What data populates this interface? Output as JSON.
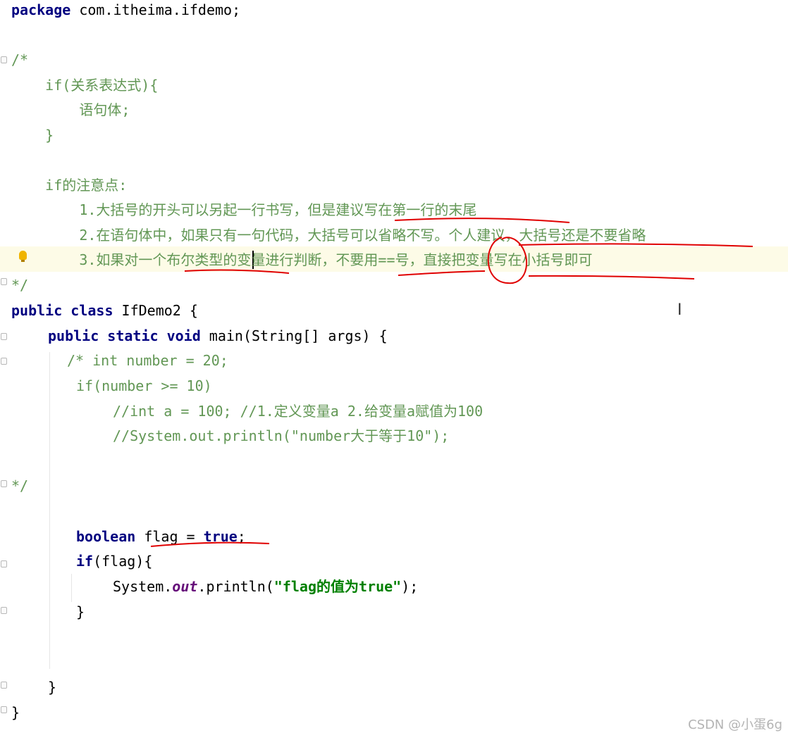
{
  "code": {
    "l1_kw": "package",
    "l1_rest": " com.itheima.ifdemo;",
    "c_open": "/*",
    "c_if": "    if(关系表达式){",
    "c_body": "        语句体;",
    "c_close_brace": "    }",
    "c_notes_title": "    if的注意点:",
    "c_note1": "        1.大括号的开头可以另起一行书写，但是建议写在第一行的末尾",
    "c_note2": "        2.在语句体中，如果只有一句代码，大括号可以省略不写。个人建议，大括号还是不要省略",
    "c_note3": "        3.如果对一个布尔类型的变量进行判断，不要用==号，直接把变量写在小括号即可",
    "c_end": "*/",
    "cls_kw": "public class",
    "cls_name": " IfDemo2 {",
    "main_kw1": "public static void",
    "main_rest": " main(String[] args) {",
    "b_open": "/* int number = 20;",
    "b_if": "if(number >= 10)",
    "b_c1": "//int a = 100; //1.定义变量a 2.给变量a赋值为100",
    "b_c2": "//System.out.println(\"number大于等于10\");",
    "b_end": "*/",
    "bool_kw": "boolean",
    "bool_mid": " flag = ",
    "bool_true": "true",
    "bool_semi": ";",
    "if_kw": "if",
    "if_rest": "(flag){",
    "print_a": "System.",
    "print_out": "out",
    "print_b": ".println(",
    "print_str": "\"flag的值为true\"",
    "print_c": ");",
    "close_if": "}",
    "close_main": "}",
    "close_class": "}"
  },
  "watermark": "CSDN @小蛋6g",
  "icons": [
    "lightbulb-icon",
    "text-cursor-icon",
    "fold-marker-icon"
  ],
  "colors": {
    "keyword": "#000080",
    "comment": "#629755",
    "string": "#008000",
    "annotation": "#e00000",
    "current_line": "#fdfbe7"
  }
}
